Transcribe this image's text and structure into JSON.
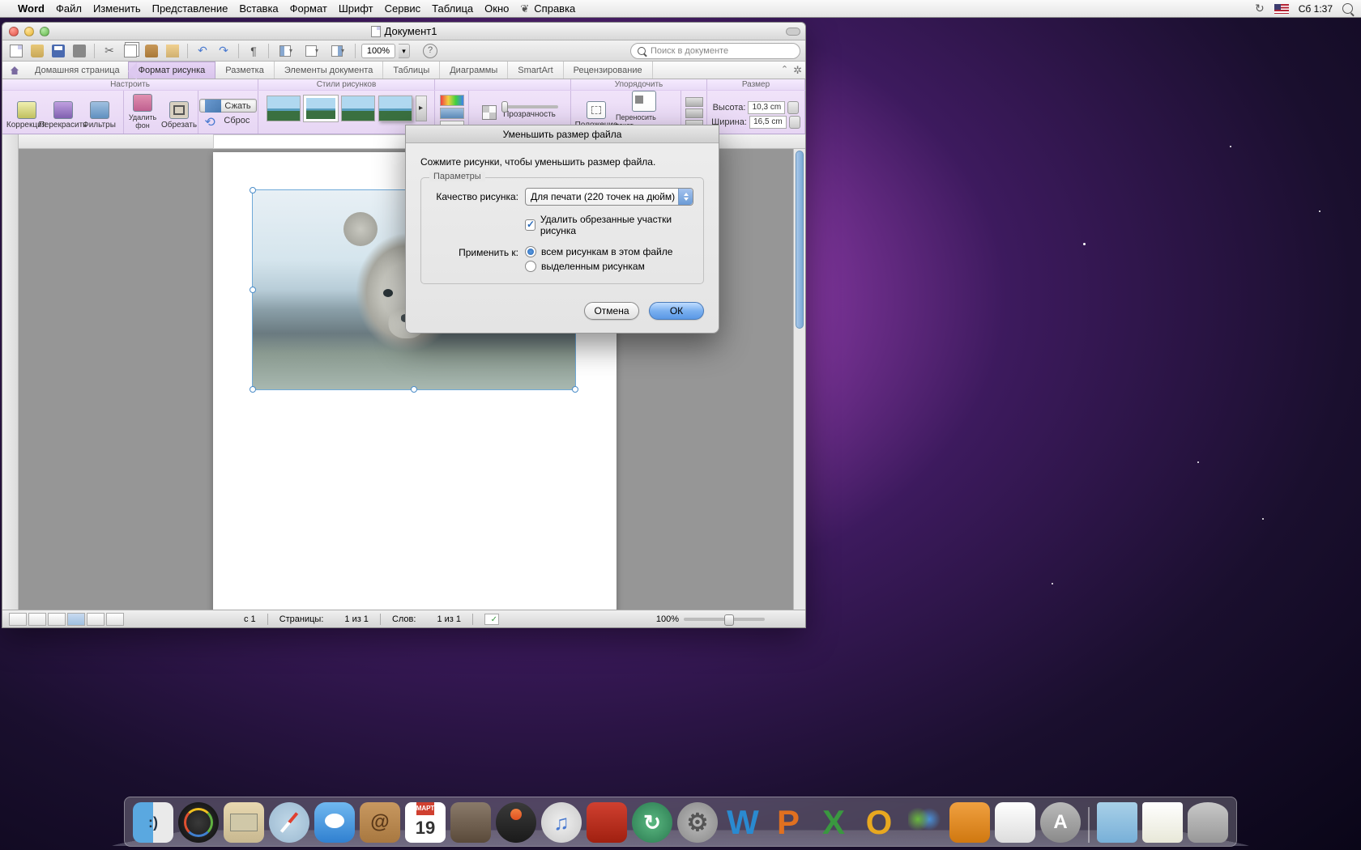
{
  "menubar": {
    "app": "Word",
    "items": [
      "Файл",
      "Изменить",
      "Представление",
      "Вставка",
      "Формат",
      "Шрифт",
      "Сервис",
      "Таблица",
      "Окно",
      "Справка"
    ],
    "clock": "Сб 1:37"
  },
  "window": {
    "title": "Документ1",
    "search_placeholder": "Поиск в документе",
    "zoom": "100%",
    "breadcrumb": "Домашняя страница",
    "tabs": [
      "Формат рисунка",
      "Разметка",
      "Элементы документа",
      "Таблицы",
      "Диаграммы",
      "SmartArt",
      "Рецензирование"
    ],
    "active_tab_index": 0
  },
  "ribbon": {
    "groups": {
      "adjust": {
        "title": "Настроить",
        "btns": [
          "Коррекция",
          "Перекрасить",
          "Фильтры"
        ]
      },
      "bg": {
        "remove_bg": "Удалить\nфон",
        "crop": "Обрезать",
        "compress": "Сжать",
        "reset": "Сброс"
      },
      "styles": {
        "title": "Стили рисунков"
      },
      "transparency": {
        "label": "Прозрачность"
      },
      "arrange": {
        "title": "Упорядочить",
        "position": "Положение",
        "wrap": "Переносить текст"
      },
      "size": {
        "title": "Размер",
        "height_label": "Высота:",
        "height_val": "10,3 cm",
        "width_label": "Ширина:",
        "width_val": "16,5 cm"
      }
    }
  },
  "dialog": {
    "title": "Уменьшить размер файла",
    "desc": "Сожмите рисунки, чтобы уменьшить размер файла.",
    "fieldset": "Параметры",
    "quality_label": "Качество рисунка:",
    "quality_value": "Для печати (220 точек на дюйм)",
    "delete_cropped": "Удалить обрезанные участки рисунка",
    "delete_cropped_checked": true,
    "apply_label": "Применить к:",
    "apply_options": [
      "всем рисункам в этом файле",
      "выделенным рисункам"
    ],
    "apply_selected": 0,
    "cancel": "Отмена",
    "ok": "ОК"
  },
  "status": {
    "section": "с   1",
    "pages_label": "Страницы:",
    "pages": "1 из 1",
    "words_label": "Слов:",
    "words": "1 из 1",
    "zoom": "100%"
  },
  "calendar": {
    "month": "МАРТ",
    "day": "19"
  }
}
